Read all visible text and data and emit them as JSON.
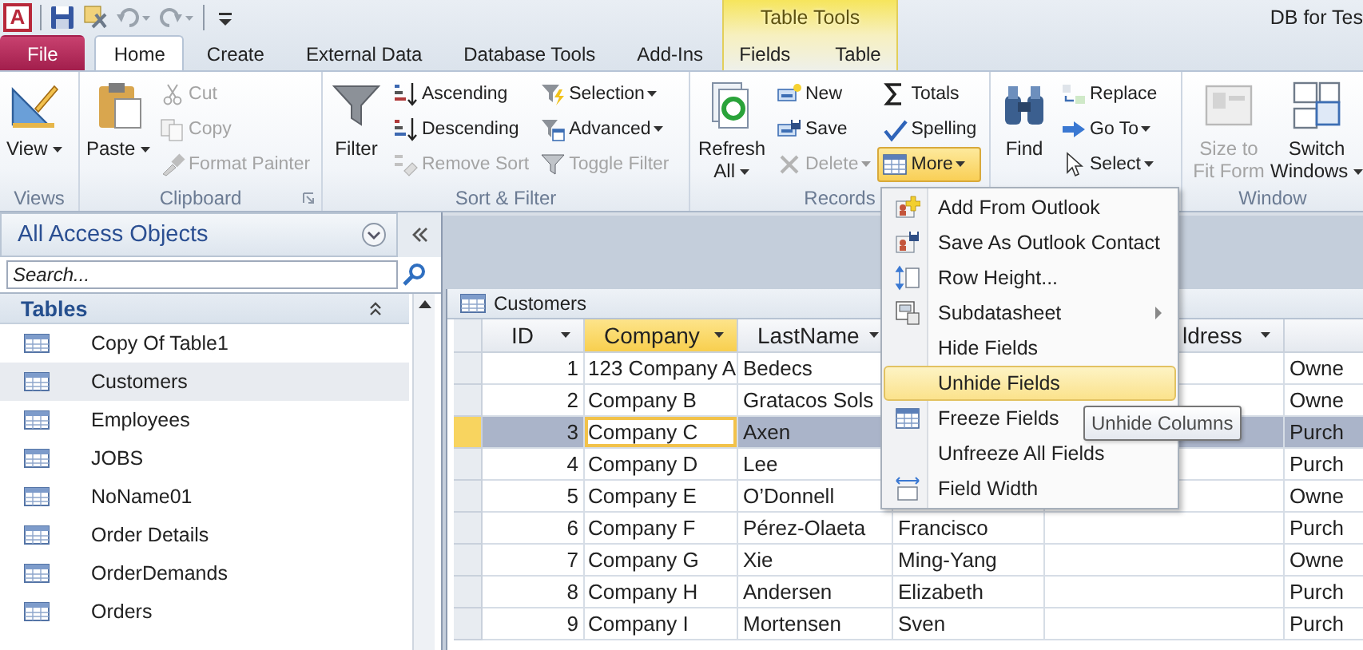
{
  "app_logo": "A",
  "title": "DB for Tes",
  "contextual_group": "Table Tools",
  "tabs": [
    {
      "label": "File",
      "kind": "file",
      "selected": false
    },
    {
      "label": "Home",
      "kind": "main",
      "selected": true
    },
    {
      "label": "Create",
      "kind": "main",
      "selected": false
    },
    {
      "label": "External Data",
      "kind": "main",
      "selected": false
    },
    {
      "label": "Database Tools",
      "kind": "main",
      "selected": false
    },
    {
      "label": "Add-Ins",
      "kind": "main",
      "selected": false
    },
    {
      "label": "Fields",
      "kind": "contextual",
      "selected": false
    },
    {
      "label": "Table",
      "kind": "contextual",
      "selected": false
    }
  ],
  "ribbon_groups": [
    {
      "label": "Views",
      "large": [
        {
          "label": "View",
          "dropdown": true,
          "disabled": false
        }
      ]
    },
    {
      "label": "Clipboard",
      "launcher": true,
      "large": [
        {
          "label": "Paste",
          "dropdown": true,
          "disabled": false
        }
      ],
      "columns": [
        [
          {
            "label": "Cut",
            "dropdown": false,
            "disabled": true,
            "pressed": false
          },
          {
            "label": "Copy",
            "dropdown": false,
            "disabled": true,
            "pressed": false
          },
          {
            "label": "Format Painter",
            "dropdown": false,
            "disabled": true,
            "pressed": false
          }
        ]
      ]
    },
    {
      "label": "Sort & Filter",
      "large": [
        {
          "label": "Filter",
          "dropdown": false,
          "disabled": false
        }
      ],
      "columns": [
        [
          {
            "label": "Ascending",
            "dropdown": false,
            "disabled": false,
            "pressed": false
          },
          {
            "label": "Descending",
            "dropdown": false,
            "disabled": false,
            "pressed": false
          },
          {
            "label": "Remove Sort",
            "dropdown": false,
            "disabled": true,
            "pressed": false
          }
        ],
        [
          {
            "label": "Selection",
            "dropdown": true,
            "disabled": false,
            "pressed": false
          },
          {
            "label": "Advanced",
            "dropdown": true,
            "disabled": false,
            "pressed": false
          },
          {
            "label": "Toggle Filter",
            "dropdown": false,
            "disabled": true,
            "pressed": false
          }
        ]
      ]
    },
    {
      "label": "Records",
      "large": [
        {
          "label": "Refresh All",
          "dropdown": true,
          "disabled": false
        }
      ],
      "columns": [
        [
          {
            "label": "New",
            "dropdown": false,
            "disabled": false,
            "pressed": false
          },
          {
            "label": "Save",
            "dropdown": false,
            "disabled": false,
            "pressed": false
          },
          {
            "label": "Delete",
            "dropdown": true,
            "disabled": true,
            "pressed": false
          }
        ],
        [
          {
            "label": "Totals",
            "dropdown": false,
            "disabled": false,
            "pressed": false
          },
          {
            "label": "Spelling",
            "dropdown": false,
            "disabled": false,
            "pressed": false
          },
          {
            "label": "More",
            "dropdown": true,
            "disabled": false,
            "pressed": true
          }
        ]
      ]
    },
    {
      "large": [
        {
          "label": "Find",
          "dropdown": false,
          "disabled": false
        }
      ],
      "columns": [
        [
          {
            "label": "Replace",
            "dropdown": false,
            "disabled": false,
            "pressed": false
          },
          {
            "label": "Go To",
            "dropdown": true,
            "disabled": false,
            "pressed": false
          },
          {
            "label": "Select",
            "dropdown": true,
            "disabled": false,
            "pressed": false
          }
        ]
      ]
    },
    {
      "label": "Window",
      "large": [
        {
          "label": "Size to Fit Form",
          "dropdown": false,
          "disabled": true
        },
        {
          "label": "Switch Windows",
          "dropdown": true,
          "disabled": false
        }
      ]
    }
  ],
  "nav": {
    "title": "All Access Objects",
    "search": {
      "placeholder": "Search..."
    },
    "groups": [
      {
        "label": "Tables",
        "expanded": true,
        "items": [
          {
            "label": "Copy Of Table1",
            "selected": false
          },
          {
            "label": "Customers",
            "selected": true
          },
          {
            "label": "Employees",
            "selected": false
          },
          {
            "label": "JOBS",
            "selected": false
          },
          {
            "label": "NoName01",
            "selected": false
          },
          {
            "label": "Order Details",
            "selected": false
          },
          {
            "label": "OrderDemands",
            "selected": false
          },
          {
            "label": "Orders",
            "selected": false
          }
        ]
      }
    ]
  },
  "datasheet": {
    "tab": "Customers",
    "columns": [
      {
        "label": "ID",
        "selected": false,
        "dropdown": true
      },
      {
        "label": "Company",
        "selected": true,
        "dropdown": true
      },
      {
        "label": "LastName",
        "selected": false,
        "dropdown": true
      },
      {},
      {
        "label": "ldress",
        "selected": false,
        "dropdown": true
      },
      {
        "selected": false
      }
    ],
    "rows": [
      {
        "id": "1",
        "company": "123 Company A",
        "last_name": "Bedecs",
        "job": "Owne",
        "selected": false,
        "editing": false
      },
      {
        "id": "2",
        "company": "Company B",
        "last_name": "Gratacos Sols",
        "job": "Owne",
        "selected": false,
        "editing": false
      },
      {
        "id": "3",
        "company": "Company C",
        "last_name": "Axen",
        "job": "Purch",
        "selected": true,
        "editing": true
      },
      {
        "id": "4",
        "company": "Company D",
        "last_name": "Lee",
        "job": "Purch",
        "selected": false,
        "editing": false
      },
      {
        "id": "5",
        "company": "Company E",
        "last_name": "O’Donnell",
        "job": "Owne",
        "selected": false,
        "editing": false
      },
      {
        "id": "6",
        "company": "Company F",
        "last_name": "Pérez-Olaeta",
        "first_name": "Francisco",
        "job": "Purch",
        "selected": false,
        "editing": false
      },
      {
        "id": "7",
        "company": "Company G",
        "last_name": "Xie",
        "first_name": "Ming-Yang",
        "job": "Owne",
        "selected": false,
        "editing": false
      },
      {
        "id": "8",
        "company": "Company H",
        "last_name": "Andersen",
        "first_name": "Elizabeth",
        "job": "Purch",
        "selected": false,
        "editing": false
      },
      {
        "id": "9",
        "company": "Company I",
        "last_name": "Mortensen",
        "first_name": "Sven",
        "job": "Purch",
        "selected": false,
        "editing": false
      }
    ]
  },
  "menu": {
    "items": [
      {
        "label": "Add From Outlook",
        "kind": "item",
        "selected": false
      },
      {
        "label": "Save As Outlook Contact",
        "kind": "item",
        "selected": false
      },
      {
        "label": "Row Height...",
        "kind": "item",
        "selected": false
      },
      {
        "label": "Subdatasheet",
        "kind": "submenu",
        "selected": false
      },
      {
        "label": "Hide Fields",
        "kind": "item",
        "selected": false
      },
      {
        "label": "Unhide Fields",
        "kind": "item",
        "selected": true
      },
      {
        "label": "Freeze Fields",
        "kind": "item",
        "selected": false
      },
      {
        "label": "Unfreeze All Fields",
        "kind": "item",
        "selected": false
      },
      {
        "label": "Field Width",
        "kind": "item",
        "selected": false
      }
    ]
  },
  "tooltip": {
    "text": "Unhide Columns"
  }
}
